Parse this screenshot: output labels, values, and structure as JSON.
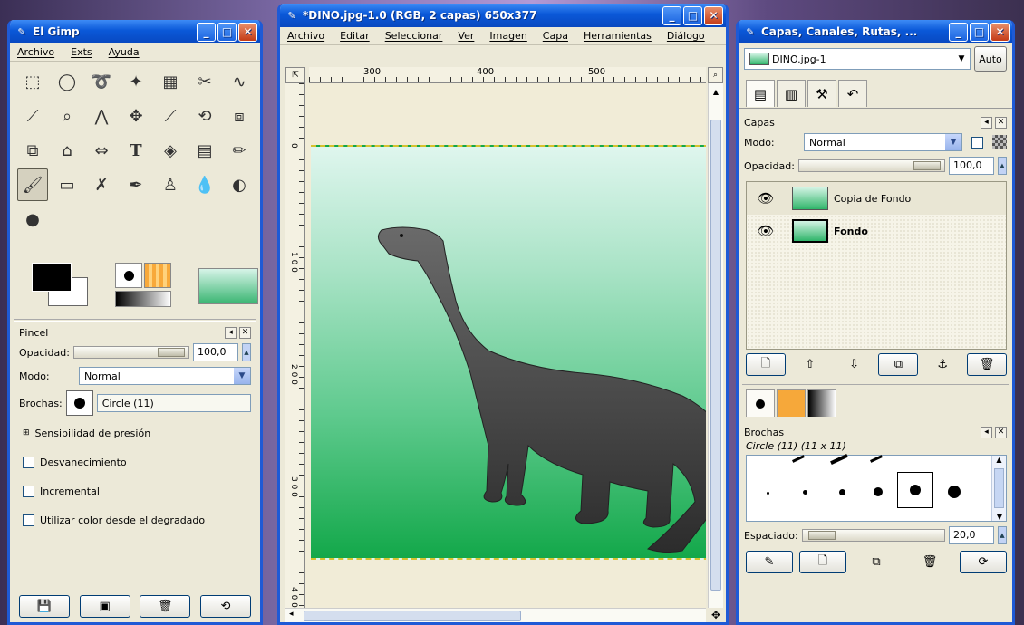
{
  "toolbox": {
    "title": "El Gimp",
    "menu": [
      "Archivo",
      "Exts",
      "Ayuda"
    ],
    "tools": [
      "rect-select",
      "ellipse-select",
      "lasso",
      "magic-wand",
      "color-select",
      "scissors",
      "paths",
      "color-picker",
      "zoom",
      "measure",
      "move",
      "crop",
      "rotate",
      "perspective",
      "flip",
      "clone-stamp",
      "scale",
      "text",
      "bucket-fill",
      "blend",
      "pencil",
      "paintbrush",
      "eraser",
      "airbrush",
      "ink",
      "clone",
      "smudge",
      "dodge-burn",
      "convolve"
    ]
  },
  "brush_options": {
    "title": "Pincel",
    "opacity_label": "Opacidad:",
    "opacity_value": "100,0",
    "mode_label": "Modo:",
    "mode_value": "Normal",
    "brush_label": "Brochas:",
    "brush_value": "Circle (11)",
    "pressure_label": "Sensibilidad de presión",
    "options": [
      "Desvanecimiento",
      "Incremental",
      "Utilizar color desde el degradado"
    ]
  },
  "image_window": {
    "title": "*DINO.jpg-1.0 (RGB, 2 capas) 650x377",
    "menu": [
      "Archivo",
      "Editar",
      "Seleccionar",
      "Ver",
      "Imagen",
      "Capa",
      "Herramientas",
      "Diálogo"
    ],
    "ruler_h": [
      "300",
      "400",
      "500"
    ],
    "ruler_v": [
      "0",
      "1 0 0",
      "2 0 0",
      "3 0 0",
      "4 0 0"
    ]
  },
  "layers_window": {
    "title": "Capas, Canales, Rutas, ...",
    "image_select": "DINO.jpg-1",
    "auto_label": "Auto",
    "section_title": "Capas",
    "mode_label": "Modo:",
    "mode_value": "Normal",
    "opacity_label": "Opacidad:",
    "opacity_value": "100,0",
    "layers": [
      {
        "name": "Copia de Fondo"
      },
      {
        "name": "Fondo"
      }
    ],
    "brushes_title": "Brochas",
    "brush_name": "Circle (11) (11 x 11)",
    "spacing_label": "Espaciado:",
    "spacing_value": "20,0"
  },
  "colors": {
    "titlebar": "#0a58d8",
    "window_bg": "#ece9d8",
    "image_green": "#13a84a"
  }
}
